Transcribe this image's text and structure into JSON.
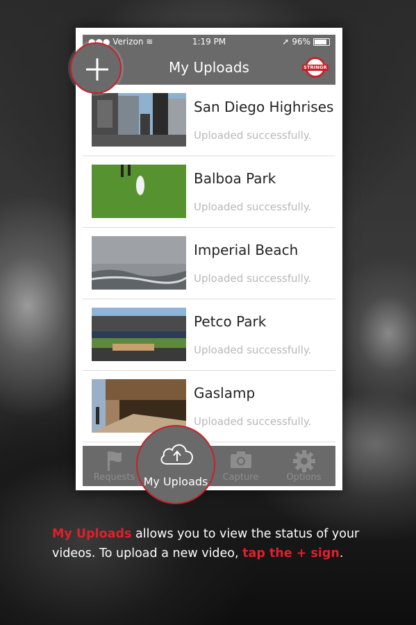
{
  "status_bar": {
    "carrier": "Verizon",
    "time": "1:19 PM",
    "battery_percent": "96%"
  },
  "nav": {
    "title": "My Uploads",
    "logo_text": "STRINGR",
    "add_icon": "plus-icon"
  },
  "uploads": [
    {
      "name": "San Diego Highrises",
      "status": "Uploaded successfully."
    },
    {
      "name": "Balboa Park",
      "status": "Uploaded successfully."
    },
    {
      "name": "Imperial Beach",
      "status": "Uploaded successfully."
    },
    {
      "name": "Petco Park",
      "status": "Uploaded successfully."
    },
    {
      "name": "Gaslamp",
      "status": "Uploaded successfully."
    }
  ],
  "tabs": [
    {
      "label": "Requests",
      "icon": "flag-icon"
    },
    {
      "label": "My Uploads",
      "icon": "cloud-upload-icon"
    },
    {
      "label": "Capture",
      "icon": "camera-icon"
    },
    {
      "label": "Options",
      "icon": "gear-icon"
    }
  ],
  "caption": {
    "highlight_1": "My Uploads",
    "text_1": " allows you to view the status of your videos. To upload a new video, ",
    "highlight_2": "tap the + sign",
    "text_2": "."
  },
  "colors": {
    "accent": "#c8202a",
    "bar": "#6a6a6a"
  }
}
